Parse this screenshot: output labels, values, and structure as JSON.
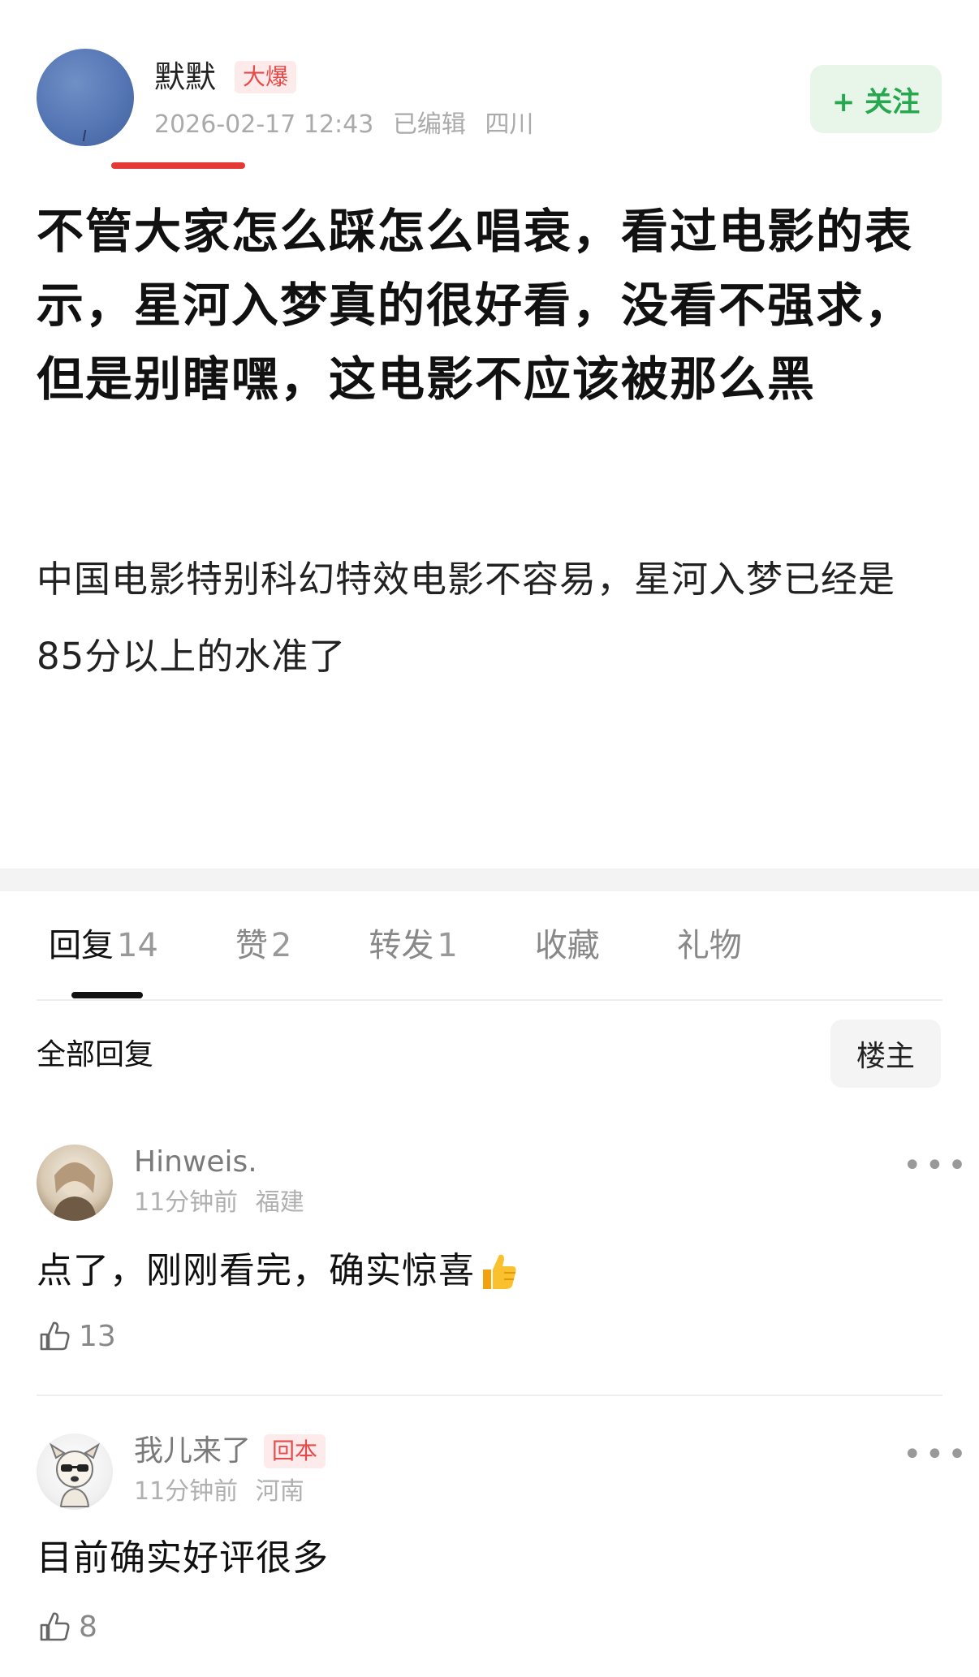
{
  "post": {
    "author": "默默",
    "author_badge": "大爆",
    "timestamp": "2026-02-17 12:43",
    "edited_label": "已编辑",
    "location": "四川",
    "follow_label": "+ 关注",
    "title": "不管大家怎么踩怎么唱衰，看过电影的表示，星河入梦真的很好看，没看不强求，但是别瞎嘿，这电影不应该被那么黑",
    "body": "中国电影特别科幻特效电影不容易，星河入梦已经是85分以上的水准了"
  },
  "tabs": [
    {
      "label": "回复",
      "count": "14"
    },
    {
      "label": "赞",
      "count": "2"
    },
    {
      "label": "转发",
      "count": "1"
    },
    {
      "label": "收藏",
      "count": ""
    },
    {
      "label": "礼物",
      "count": ""
    }
  ],
  "replies_header": {
    "title": "全部回复",
    "filter_label": "楼主"
  },
  "comments": [
    {
      "name": "Hinweis.",
      "badge": "",
      "time": "11分钟前",
      "location": "福建",
      "text": "点了，刚刚看完，确实惊喜",
      "likes": "13",
      "more": "•••"
    },
    {
      "name": "我儿来了",
      "badge": "回本",
      "time": "11分钟前",
      "location": "河南",
      "text": "目前确实好评很多",
      "likes": "8",
      "more": "•••"
    }
  ],
  "colors": {
    "accent_red": "#e53935",
    "follow_green": "#27a84f",
    "badge_red": "#e64b4b"
  }
}
